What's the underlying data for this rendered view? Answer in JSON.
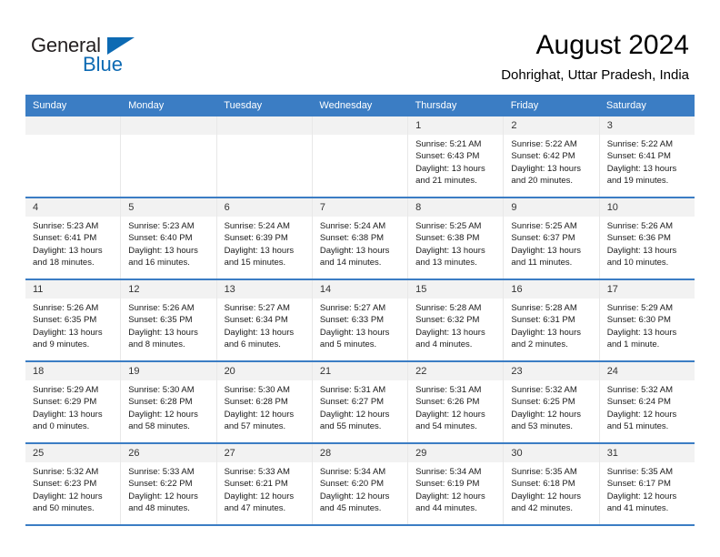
{
  "brand": {
    "name_part1": "General",
    "name_part2": "Blue",
    "triangle_color": "#0d6ab3",
    "text_color": "#231f20"
  },
  "header": {
    "title": "August 2024",
    "subtitle": "Dohrighat, Uttar Pradesh, India"
  },
  "theme": {
    "header_bar": "#3b7dc4",
    "day_number_bg": "#f2f2f2",
    "cell_border": "#e8e8e8"
  },
  "weekdays": [
    "Sunday",
    "Monday",
    "Tuesday",
    "Wednesday",
    "Thursday",
    "Friday",
    "Saturday"
  ],
  "weeks": [
    [
      {
        "day": "",
        "empty": true
      },
      {
        "day": "",
        "empty": true
      },
      {
        "day": "",
        "empty": true
      },
      {
        "day": "",
        "empty": true
      },
      {
        "day": "1",
        "sunrise": "Sunrise: 5:21 AM",
        "sunset": "Sunset: 6:43 PM",
        "daylight": "Daylight: 13 hours and 21 minutes."
      },
      {
        "day": "2",
        "sunrise": "Sunrise: 5:22 AM",
        "sunset": "Sunset: 6:42 PM",
        "daylight": "Daylight: 13 hours and 20 minutes."
      },
      {
        "day": "3",
        "sunrise": "Sunrise: 5:22 AM",
        "sunset": "Sunset: 6:41 PM",
        "daylight": "Daylight: 13 hours and 19 minutes."
      }
    ],
    [
      {
        "day": "4",
        "sunrise": "Sunrise: 5:23 AM",
        "sunset": "Sunset: 6:41 PM",
        "daylight": "Daylight: 13 hours and 18 minutes."
      },
      {
        "day": "5",
        "sunrise": "Sunrise: 5:23 AM",
        "sunset": "Sunset: 6:40 PM",
        "daylight": "Daylight: 13 hours and 16 minutes."
      },
      {
        "day": "6",
        "sunrise": "Sunrise: 5:24 AM",
        "sunset": "Sunset: 6:39 PM",
        "daylight": "Daylight: 13 hours and 15 minutes."
      },
      {
        "day": "7",
        "sunrise": "Sunrise: 5:24 AM",
        "sunset": "Sunset: 6:38 PM",
        "daylight": "Daylight: 13 hours and 14 minutes."
      },
      {
        "day": "8",
        "sunrise": "Sunrise: 5:25 AM",
        "sunset": "Sunset: 6:38 PM",
        "daylight": "Daylight: 13 hours and 13 minutes."
      },
      {
        "day": "9",
        "sunrise": "Sunrise: 5:25 AM",
        "sunset": "Sunset: 6:37 PM",
        "daylight": "Daylight: 13 hours and 11 minutes."
      },
      {
        "day": "10",
        "sunrise": "Sunrise: 5:26 AM",
        "sunset": "Sunset: 6:36 PM",
        "daylight": "Daylight: 13 hours and 10 minutes."
      }
    ],
    [
      {
        "day": "11",
        "sunrise": "Sunrise: 5:26 AM",
        "sunset": "Sunset: 6:35 PM",
        "daylight": "Daylight: 13 hours and 9 minutes."
      },
      {
        "day": "12",
        "sunrise": "Sunrise: 5:26 AM",
        "sunset": "Sunset: 6:35 PM",
        "daylight": "Daylight: 13 hours and 8 minutes."
      },
      {
        "day": "13",
        "sunrise": "Sunrise: 5:27 AM",
        "sunset": "Sunset: 6:34 PM",
        "daylight": "Daylight: 13 hours and 6 minutes."
      },
      {
        "day": "14",
        "sunrise": "Sunrise: 5:27 AM",
        "sunset": "Sunset: 6:33 PM",
        "daylight": "Daylight: 13 hours and 5 minutes."
      },
      {
        "day": "15",
        "sunrise": "Sunrise: 5:28 AM",
        "sunset": "Sunset: 6:32 PM",
        "daylight": "Daylight: 13 hours and 4 minutes."
      },
      {
        "day": "16",
        "sunrise": "Sunrise: 5:28 AM",
        "sunset": "Sunset: 6:31 PM",
        "daylight": "Daylight: 13 hours and 2 minutes."
      },
      {
        "day": "17",
        "sunrise": "Sunrise: 5:29 AM",
        "sunset": "Sunset: 6:30 PM",
        "daylight": "Daylight: 13 hours and 1 minute."
      }
    ],
    [
      {
        "day": "18",
        "sunrise": "Sunrise: 5:29 AM",
        "sunset": "Sunset: 6:29 PM",
        "daylight": "Daylight: 13 hours and 0 minutes."
      },
      {
        "day": "19",
        "sunrise": "Sunrise: 5:30 AM",
        "sunset": "Sunset: 6:28 PM",
        "daylight": "Daylight: 12 hours and 58 minutes."
      },
      {
        "day": "20",
        "sunrise": "Sunrise: 5:30 AM",
        "sunset": "Sunset: 6:28 PM",
        "daylight": "Daylight: 12 hours and 57 minutes."
      },
      {
        "day": "21",
        "sunrise": "Sunrise: 5:31 AM",
        "sunset": "Sunset: 6:27 PM",
        "daylight": "Daylight: 12 hours and 55 minutes."
      },
      {
        "day": "22",
        "sunrise": "Sunrise: 5:31 AM",
        "sunset": "Sunset: 6:26 PM",
        "daylight": "Daylight: 12 hours and 54 minutes."
      },
      {
        "day": "23",
        "sunrise": "Sunrise: 5:32 AM",
        "sunset": "Sunset: 6:25 PM",
        "daylight": "Daylight: 12 hours and 53 minutes."
      },
      {
        "day": "24",
        "sunrise": "Sunrise: 5:32 AM",
        "sunset": "Sunset: 6:24 PM",
        "daylight": "Daylight: 12 hours and 51 minutes."
      }
    ],
    [
      {
        "day": "25",
        "sunrise": "Sunrise: 5:32 AM",
        "sunset": "Sunset: 6:23 PM",
        "daylight": "Daylight: 12 hours and 50 minutes."
      },
      {
        "day": "26",
        "sunrise": "Sunrise: 5:33 AM",
        "sunset": "Sunset: 6:22 PM",
        "daylight": "Daylight: 12 hours and 48 minutes."
      },
      {
        "day": "27",
        "sunrise": "Sunrise: 5:33 AM",
        "sunset": "Sunset: 6:21 PM",
        "daylight": "Daylight: 12 hours and 47 minutes."
      },
      {
        "day": "28",
        "sunrise": "Sunrise: 5:34 AM",
        "sunset": "Sunset: 6:20 PM",
        "daylight": "Daylight: 12 hours and 45 minutes."
      },
      {
        "day": "29",
        "sunrise": "Sunrise: 5:34 AM",
        "sunset": "Sunset: 6:19 PM",
        "daylight": "Daylight: 12 hours and 44 minutes."
      },
      {
        "day": "30",
        "sunrise": "Sunrise: 5:35 AM",
        "sunset": "Sunset: 6:18 PM",
        "daylight": "Daylight: 12 hours and 42 minutes."
      },
      {
        "day": "31",
        "sunrise": "Sunrise: 5:35 AM",
        "sunset": "Sunset: 6:17 PM",
        "daylight": "Daylight: 12 hours and 41 minutes."
      }
    ]
  ]
}
